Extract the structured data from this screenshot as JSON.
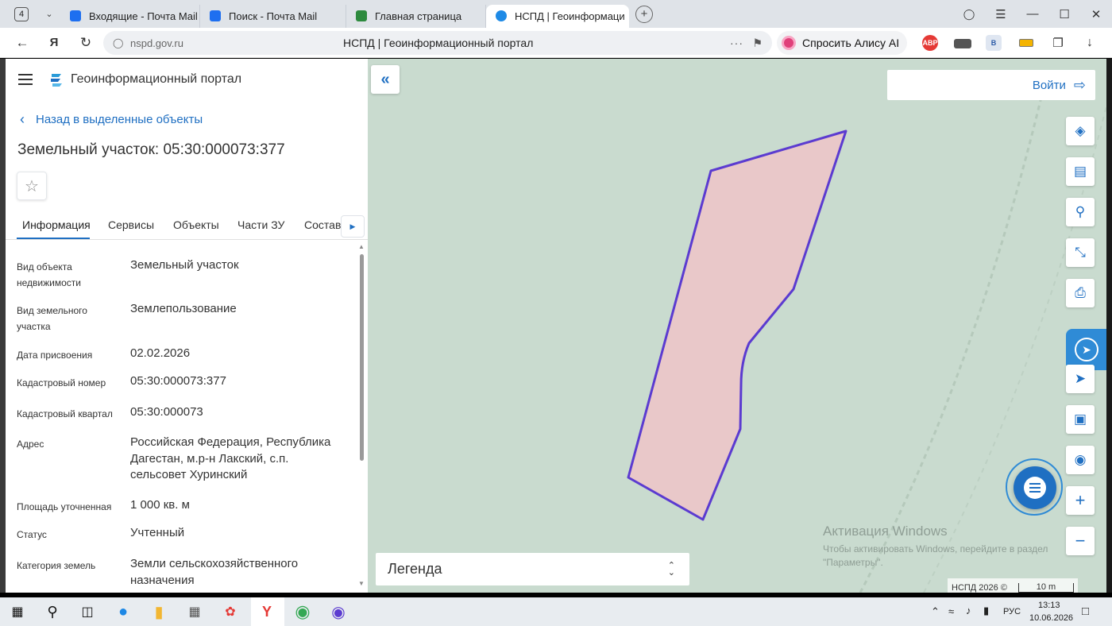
{
  "browser": {
    "tab_count": "4",
    "tabs": [
      {
        "title": "Входящие - Почта Mail",
        "icon": "mail-icon",
        "color": "#1e6ff0"
      },
      {
        "title": "Поиск - Почта Mail",
        "icon": "mail-icon",
        "color": "#1e6ff0"
      },
      {
        "title": "Главная страница",
        "icon": "gosuslugi-icon",
        "color": "#2d8a3e"
      },
      {
        "title": "НСПД | Геоинформаци",
        "icon": "nspd-icon",
        "color": "#1e8ae6"
      }
    ],
    "address": {
      "url": "nspd.gov.ru",
      "title": "НСПД | Геоинформационный портал"
    },
    "alice_label": "Спросить Алису AI",
    "ext_abp": "ABP",
    "ext_b": "B"
  },
  "panel": {
    "brand": "Геоинформационный портал",
    "back_label": "Назад в выделенные объекты",
    "title": "Земельный участок: 05:30:000073:377",
    "tabs": [
      {
        "label": "Информация"
      },
      {
        "label": "Сервисы"
      },
      {
        "label": "Объекты"
      },
      {
        "label": "Части ЗУ"
      },
      {
        "label": "Состав"
      }
    ],
    "info": [
      {
        "label": "Вид объекта недвижимости",
        "value": "Земельный участок"
      },
      {
        "label": "Вид земельного участка",
        "value": "Землепользование"
      },
      {
        "label": "Дата присвоения",
        "value": "02.02.2026"
      },
      {
        "label": "Кадастровый номер",
        "value": "05:30:000073:377"
      },
      {
        "label": "Кадастровый квартал",
        "value": "05:30:000073"
      },
      {
        "label": "Адрес",
        "value": "Российская Федерация, Республика Дагестан, м.р-н Лакский, с.п. сельсовет Хуринский"
      },
      {
        "label": "Площадь уточненная",
        "value": "1 000 кв. м"
      },
      {
        "label": "Статус",
        "value": "Учтенный"
      },
      {
        "label": "Категория земель",
        "value": "Земли сельскохозяйственного назначения"
      }
    ]
  },
  "map": {
    "login_label": "Войти",
    "legend_label": "Легенда",
    "copyright": "НСПД 2026 ©",
    "scale_label": "10 m",
    "watermark_title": "Активация Windows",
    "watermark_line1": "Чтобы активировать Windows, перейдите в раздел",
    "watermark_line2": "\"Параметры\".",
    "parcel_fill": "#e9c8c9",
    "parcel_stroke": "#5b3bd0"
  },
  "taskbar": {
    "language": "РУС",
    "time": "13:13",
    "date": "10.06.2026"
  }
}
